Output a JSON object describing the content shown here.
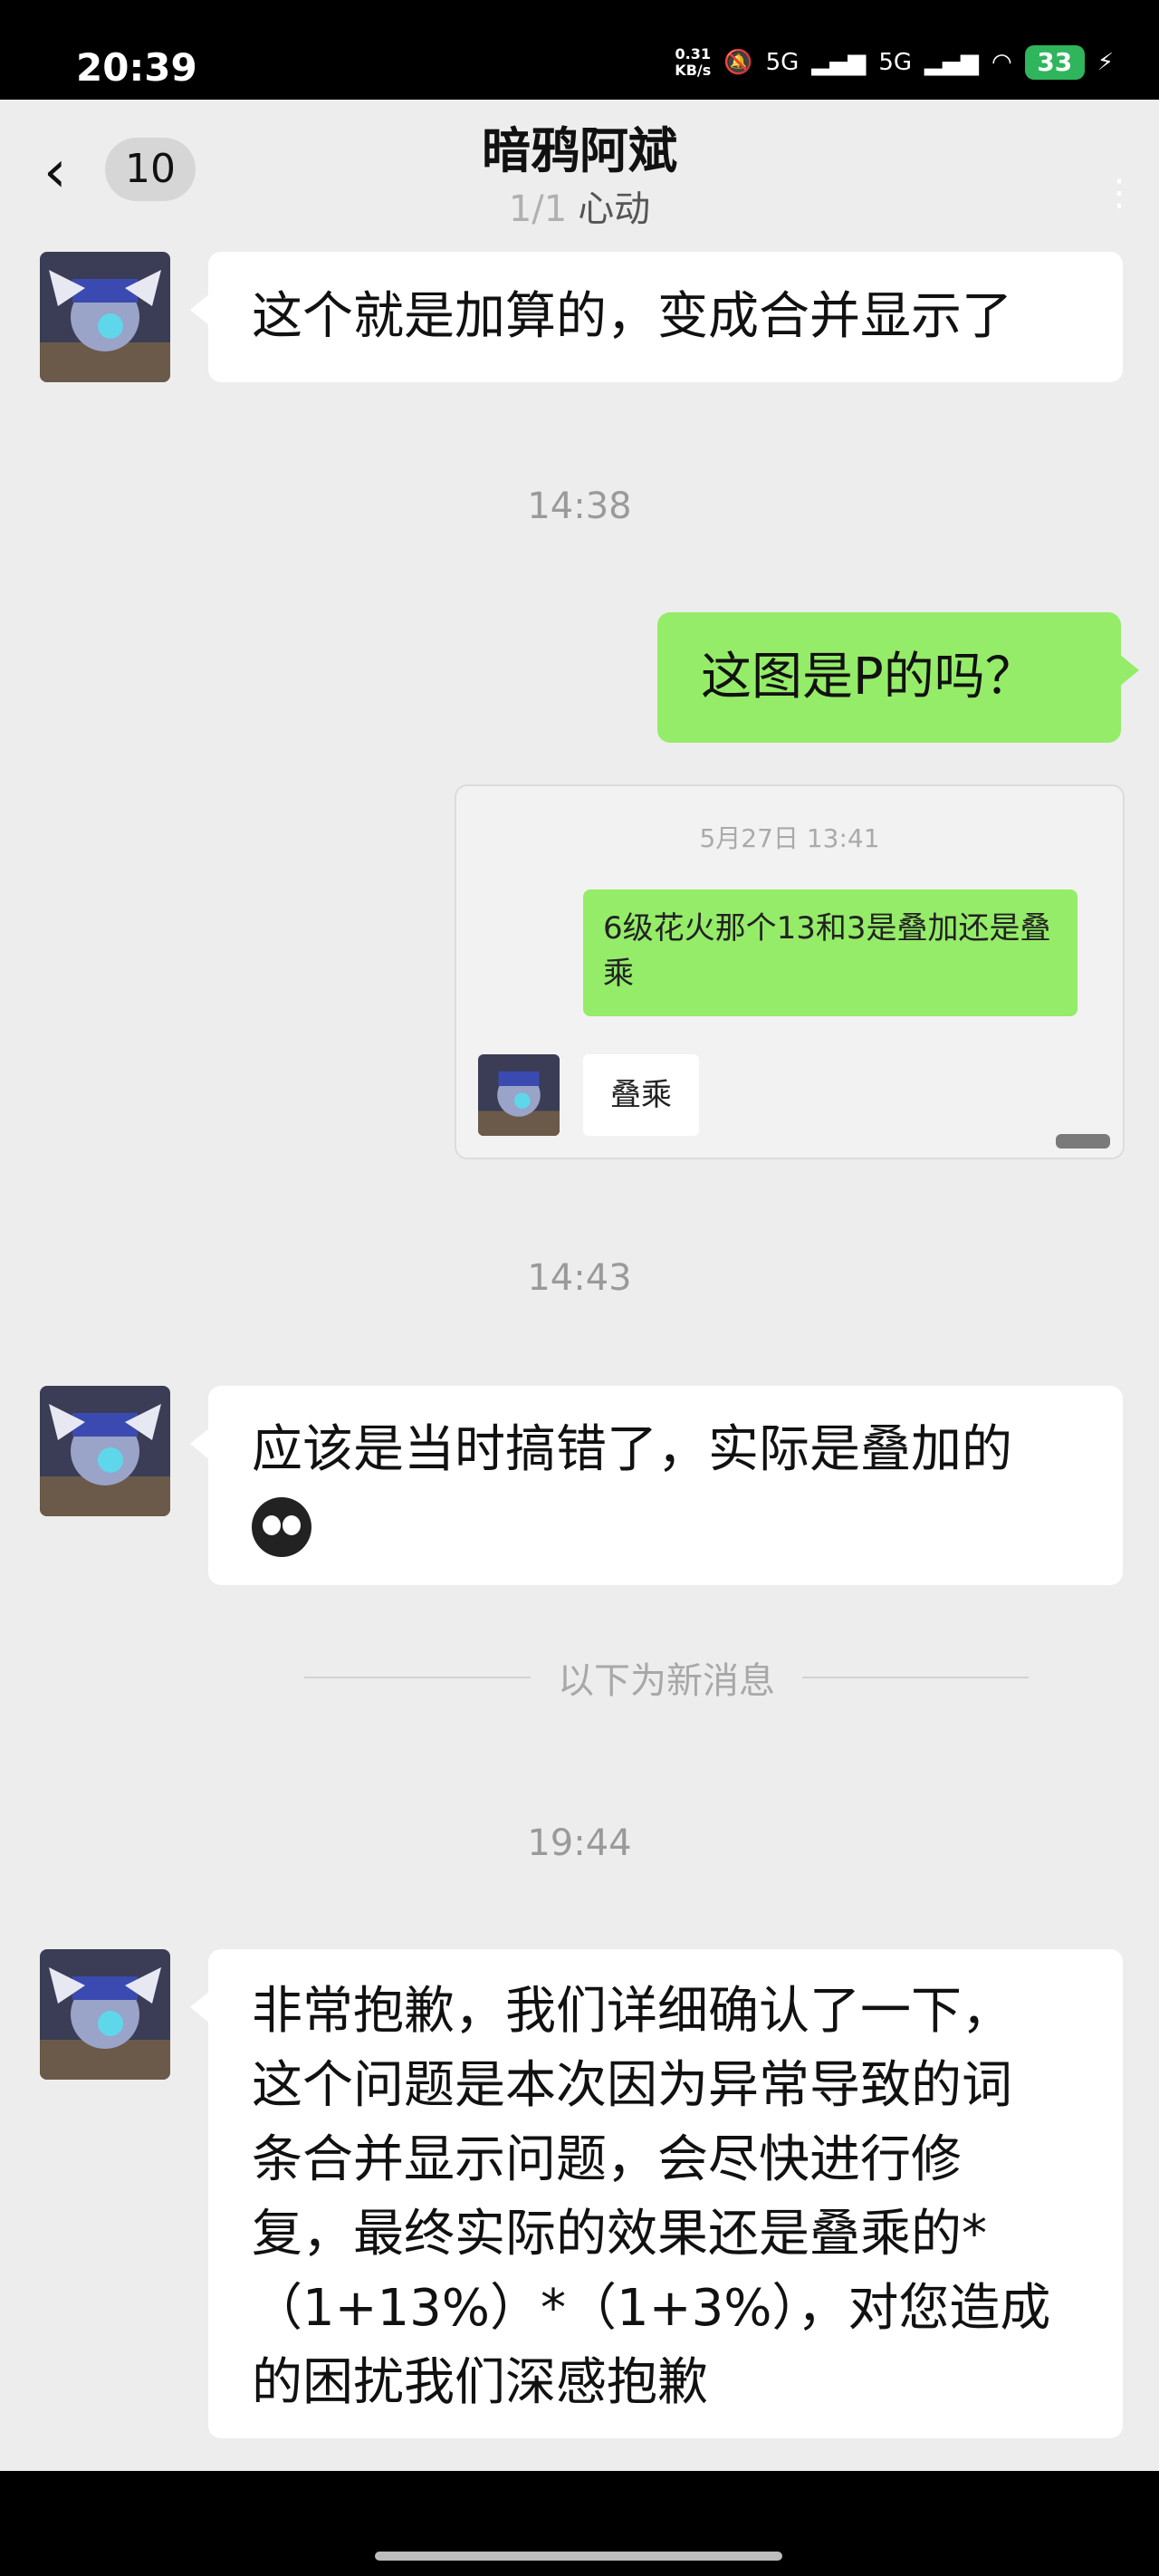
{
  "status": {
    "time": "20:39",
    "net_speed_value": "0.31",
    "net_speed_unit": "KB/s",
    "signal1": "5G",
    "signal2": "5G",
    "battery": "33"
  },
  "header": {
    "back_icon": "chevron-left-icon",
    "unread_count": "10",
    "title": "暗鸦阿斌",
    "page_indicator": "1/1",
    "subtitle": "心动",
    "more_icon": "more-vertical-icon"
  },
  "messages": [
    {
      "side": "left",
      "text": "这个就是加算的，变成合并显示了"
    },
    {
      "type": "time",
      "text": "14:38"
    },
    {
      "side": "right",
      "text": "这图是P的吗？"
    },
    {
      "type": "image",
      "inner_time": "5月27日 13:41",
      "inner_question": "6级花火那个13和3是叠加还是叠乘",
      "inner_reply": "叠乘"
    },
    {
      "type": "time",
      "text": "14:43"
    },
    {
      "side": "left",
      "text": "应该是当时搞错了，实际是叠加的",
      "emoji": "crying-face-emoji"
    },
    {
      "type": "divider",
      "text": "以下为新消息"
    },
    {
      "type": "time",
      "text": "19:44"
    },
    {
      "side": "left",
      "lines": [
        "非常抱歉，我们详细确认了一下，",
        "这个问题是本次因为异常导致的词",
        "条合并显示问题，会尽快进行修",
        "复，最终实际的效果还是叠乘的*",
        "（1+13%）*（1+3%），对您造成",
        "的困扰我们深感抱歉"
      ]
    }
  ],
  "colors": {
    "background": "#ededed",
    "bubble_self": "#95ec69",
    "bubble_other": "#ffffff",
    "battery": "#2fb55b"
  }
}
